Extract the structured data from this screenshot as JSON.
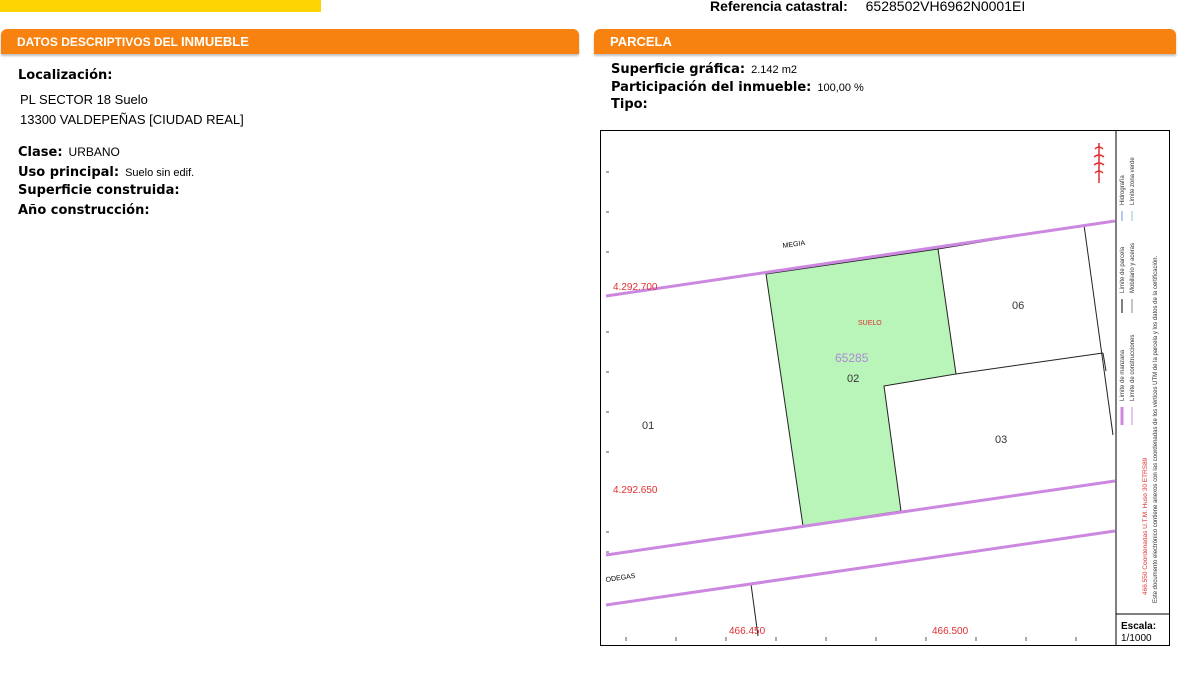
{
  "header": {
    "ref_label": "Referencia catastral:",
    "ref_value": "6528502VH6962N0001EI"
  },
  "left_section": {
    "title_prefix": "DATOS DESCRIPTIVOS DEL ",
    "title_bold": "INMUEBLE",
    "localizacion_label": "Localización:",
    "address_line1": "PL SECTOR 18  Suelo",
    "address_line2": "13300 VALDEPEÑAS [CIUDAD REAL]",
    "clase_label": "Clase:",
    "clase_value": "URBANO",
    "uso_label": "Uso principal:",
    "uso_value": "Suelo sin edif.",
    "superficie_label": "Superficie construida:",
    "anio_label": "Año construcción:"
  },
  "right_section": {
    "title": "PARCELA",
    "superficie_grafica_label": "Superficie gráfica:",
    "superficie_grafica_value": "2.142 m2",
    "participacion_label": "Participación del inmueble:",
    "participacion_value": "100,00 %",
    "tipo_label": "Tipo:"
  },
  "map": {
    "street_top": "MEGIA",
    "street_bottom": "ODEGAS",
    "parcel_label": "SUELO",
    "parcel_ref": "65285",
    "lot_01": "01",
    "lot_02": "02",
    "lot_03": "03",
    "lot_06": "06",
    "y_coord_top": "4.292.700",
    "y_coord_bottom": "4.292.650",
    "x_coord_left": "466.450",
    "x_coord_right": "466.500",
    "legend_manzana": "Límite de manzana",
    "legend_construcciones": "Límite de construcciones",
    "legend_parcela": "Límite de parcela",
    "legend_mobiliario": "Mobiliario y aceras",
    "legend_hidrografia": "Hidrografía",
    "legend_zona_verde": "Límite zona verde",
    "coords_note": "466.550 Coordenadas U.T.M. Huso 30 ETRS89",
    "doc_note": "Este documento electrónico contiene anexos con las coordenadas de los vértices UTM de la parcela y los datos de la certificación.",
    "scale_label": "Escala:",
    "scale_value": "1/1000",
    "colors": {
      "parcel_fill": "#b9f5b9",
      "block_line": "#cc88e0",
      "coord_text": "#e03030",
      "header_orange": "#f7820f",
      "top_bar_yellow": "#fdd400"
    }
  }
}
